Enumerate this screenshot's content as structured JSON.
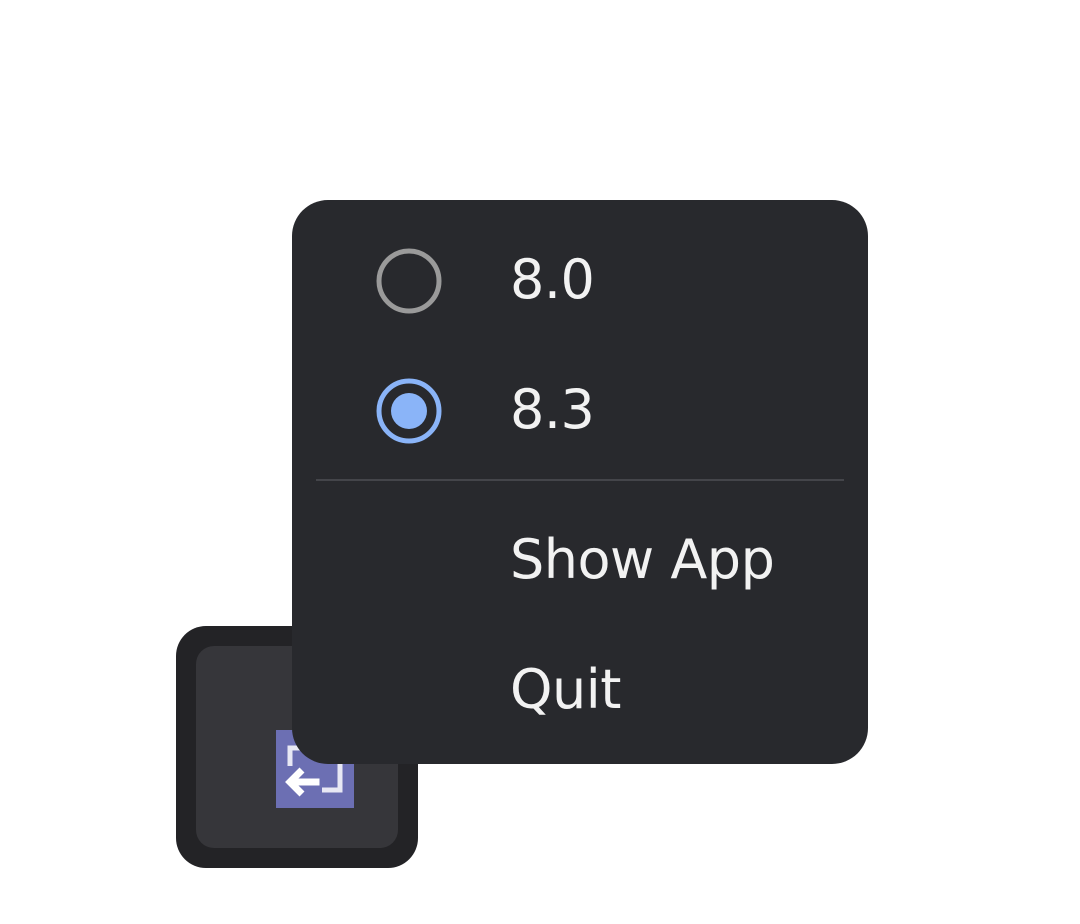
{
  "tray": {
    "icon": "tray-app-icon",
    "accent_color": "#6c6fb3"
  },
  "menu": {
    "radio_items": [
      {
        "label": "8.0",
        "checked": false,
        "icon": "radio-unchecked-icon"
      },
      {
        "label": "8.3",
        "checked": true,
        "icon": "radio-checked-icon"
      }
    ],
    "actions": [
      {
        "label": "Show App"
      },
      {
        "label": "Quit"
      }
    ],
    "colors": {
      "background": "#28292d",
      "text": "#f2f2f2",
      "radio_selected": "#8ab4f8",
      "radio_unselected": "#9a9a9a"
    }
  }
}
